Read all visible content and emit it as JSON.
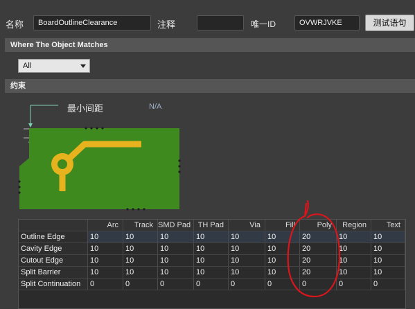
{
  "header": {
    "name_label": "名称",
    "name_value": "BoardOutlineClearance",
    "comment_label": "注释",
    "comment_value": "",
    "uid_label": "唯一ID",
    "uid_value": "OVWRJVKE",
    "test_button": "测试语句"
  },
  "where_section": {
    "title": "Where The Object Matches",
    "dropdown_value": "All"
  },
  "constraint_section": {
    "title": "约束",
    "min_clearance_label": "最小间距",
    "min_clearance_value": "N/A"
  },
  "table": {
    "columns": [
      "Arc",
      "Track",
      "SMD Pad",
      "TH Pad",
      "Via",
      "Fill",
      "Poly",
      "Region",
      "Text"
    ],
    "rows": [
      {
        "name": "Outline Edge",
        "values": [
          "10",
          "10",
          "10",
          "10",
          "10",
          "10",
          "20",
          "10",
          "10"
        ]
      },
      {
        "name": "Cavity Edge",
        "values": [
          "10",
          "10",
          "10",
          "10",
          "10",
          "10",
          "20",
          "10",
          "10"
        ]
      },
      {
        "name": "Cutout Edge",
        "values": [
          "10",
          "10",
          "10",
          "10",
          "10",
          "10",
          "20",
          "10",
          "10"
        ]
      },
      {
        "name": "Split Barrier",
        "values": [
          "10",
          "10",
          "10",
          "10",
          "10",
          "10",
          "20",
          "10",
          "10"
        ]
      },
      {
        "name": "Split Continuation",
        "values": [
          "0",
          "0",
          "0",
          "0",
          "0",
          "0",
          "0",
          "0",
          "0"
        ]
      }
    ]
  },
  "colors": {
    "background": "#3c3c3c",
    "board_green": "#3f8a1e",
    "trace_gold": "#e6b21e",
    "annotation_red": "#d8161c",
    "selected_cell": "#5f87ad"
  }
}
